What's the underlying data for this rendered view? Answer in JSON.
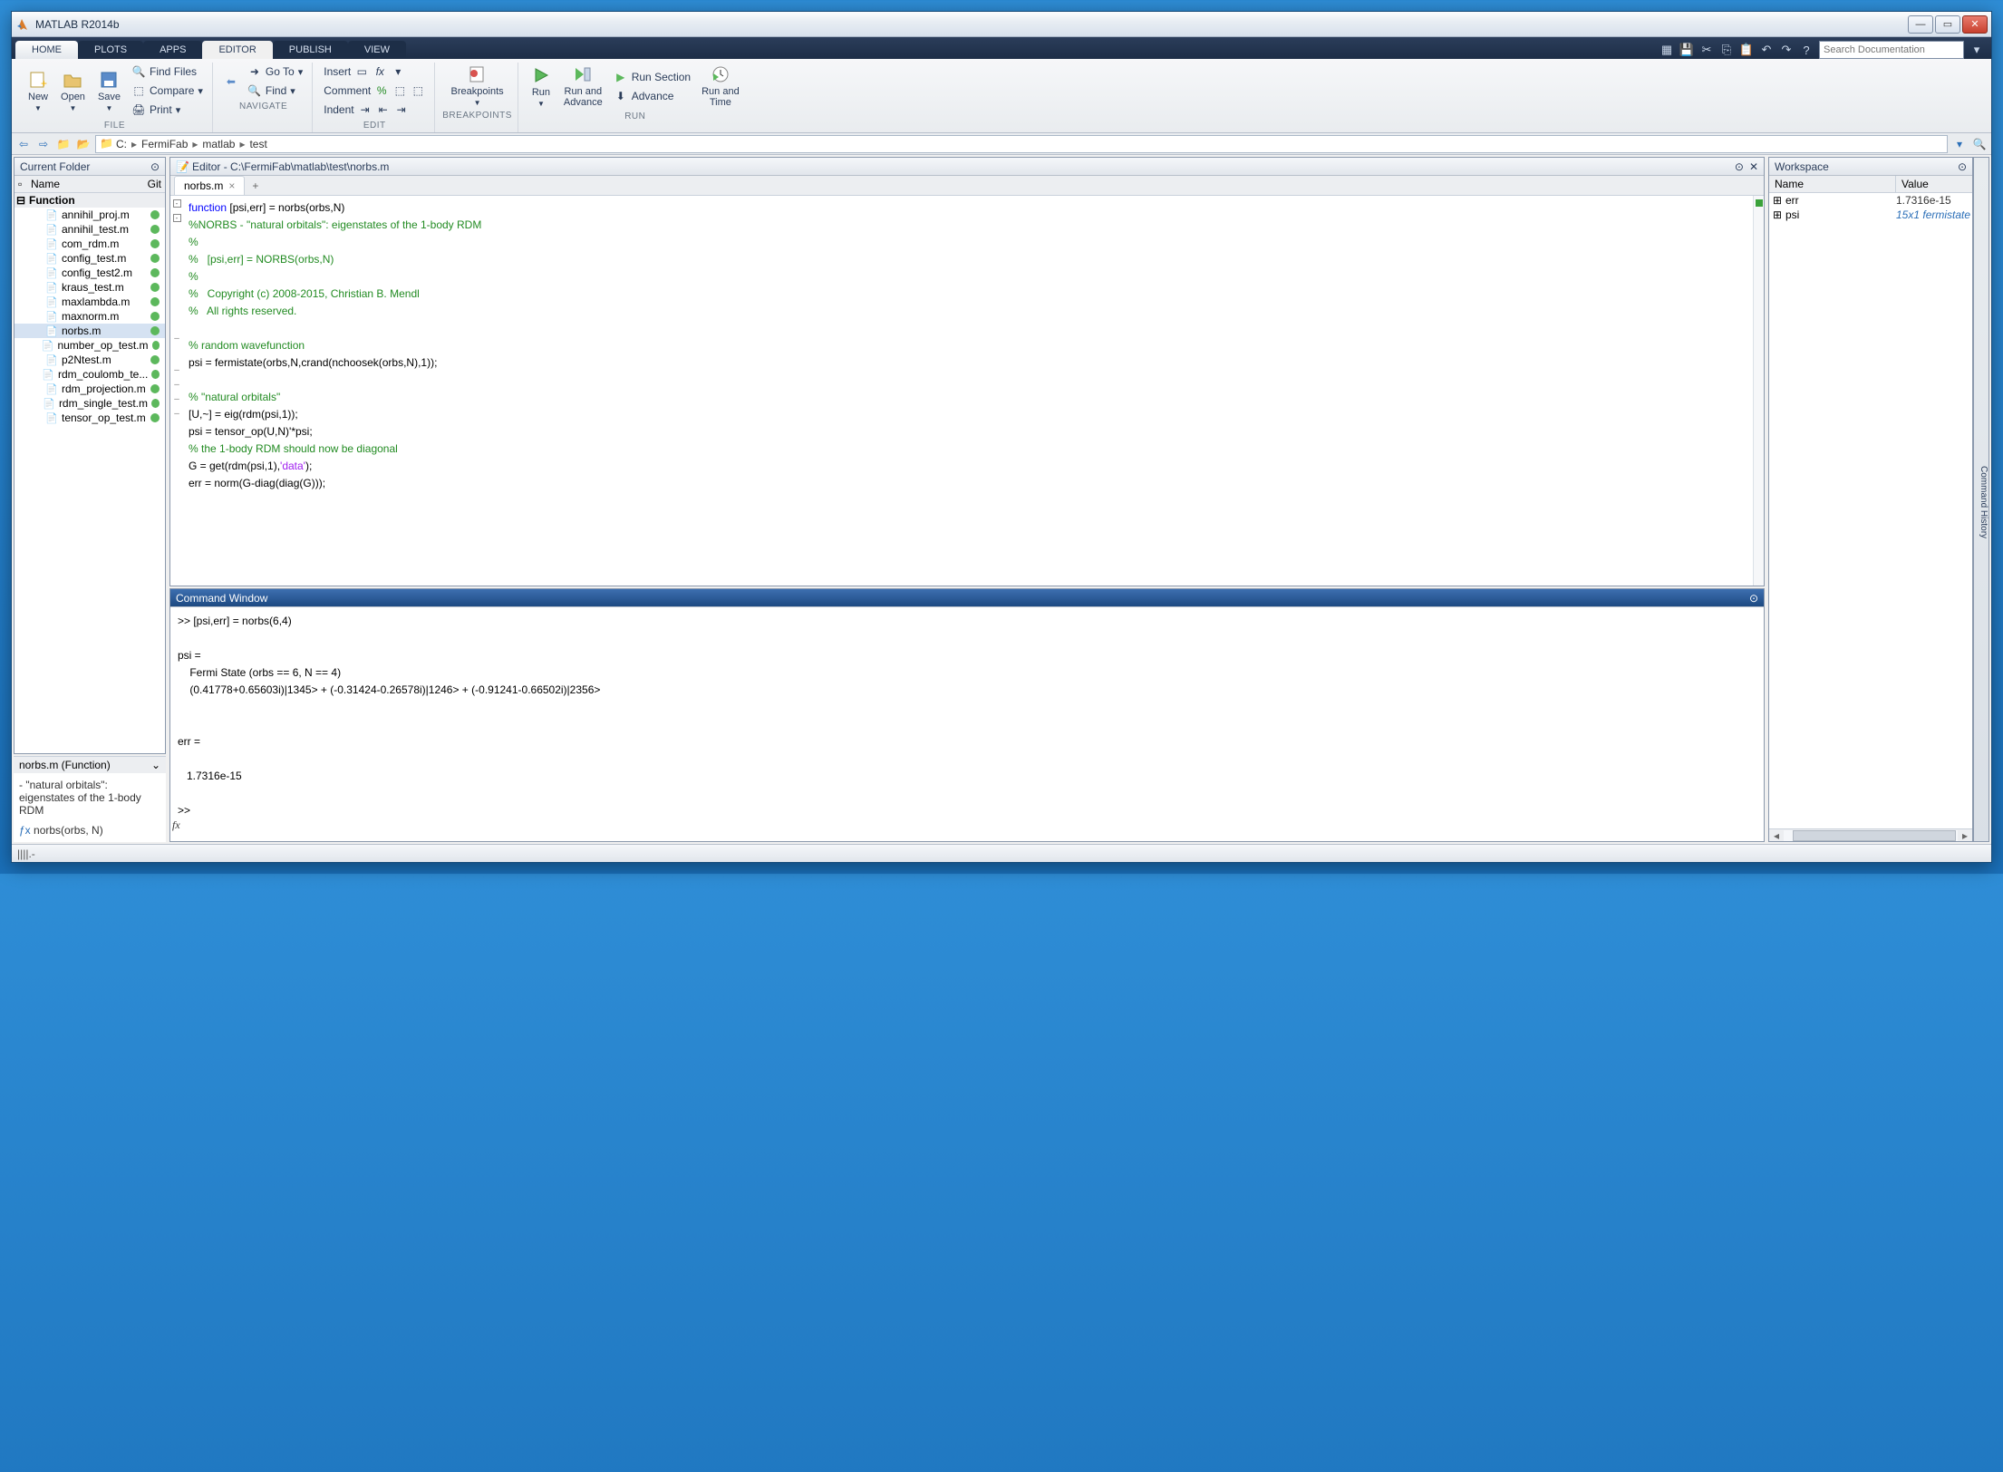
{
  "titlebar": {
    "title": "MATLAB R2014b"
  },
  "main_tabs": [
    "HOME",
    "PLOTS",
    "APPS",
    "EDITOR",
    "PUBLISH",
    "VIEW"
  ],
  "active_main_tab": 3,
  "search_placeholder": "Search Documentation",
  "toolstrip": {
    "file": {
      "new": "New",
      "open": "Open",
      "save": "Save",
      "find_files": "Find Files",
      "compare": "Compare",
      "print": "Print",
      "label": "FILE"
    },
    "navigate": {
      "goto": "Go To",
      "find": "Find",
      "label": "NAVIGATE"
    },
    "edit": {
      "insert": "Insert",
      "comment": "Comment",
      "indent": "Indent",
      "label": "EDIT"
    },
    "breakpoints": {
      "btn": "Breakpoints",
      "label": "BREAKPOINTS"
    },
    "run": {
      "run": "Run",
      "run_advance": "Run and\nAdvance",
      "run_section": "Run Section",
      "advance": "Advance",
      "run_time": "Run and\nTime",
      "label": "RUN"
    }
  },
  "breadcrumb": [
    "C:",
    "FermiFab",
    "matlab",
    "test"
  ],
  "current_folder": {
    "title": "Current Folder",
    "cols": {
      "name": "Name",
      "git": "Git"
    },
    "group": "Function",
    "files": [
      "annihil_proj.m",
      "annihil_test.m",
      "com_rdm.m",
      "config_test.m",
      "config_test2.m",
      "kraus_test.m",
      "maxlambda.m",
      "maxnorm.m",
      "norbs.m",
      "number_op_test.m",
      "p2Ntest.m",
      "rdm_coulomb_te...",
      "rdm_projection.m",
      "rdm_single_test.m",
      "tensor_op_test.m"
    ],
    "selected": "norbs.m"
  },
  "func_panel": {
    "head": "norbs.m (Function)",
    "desc": "- \"natural orbitals\": eigenstates of the 1-body RDM",
    "sig": "norbs(orbs, N)"
  },
  "editor": {
    "title": "Editor - C:\\FermiFab\\matlab\\test\\norbs.m",
    "tab": "norbs.m",
    "code": {
      "l1a": "function",
      "l1b": " [psi,err] = norbs(orbs,N)",
      "l2": "%NORBS - \"natural orbitals\": eigenstates of the 1-body RDM",
      "l3": "%",
      "l4": "%   [psi,err] = NORBS(orbs,N)",
      "l5": "%",
      "l6": "%   Copyright (c) 2008-2015, Christian B. Mendl",
      "l7": "%   All rights reserved.",
      "l9": "% random wavefunction",
      "l10": "psi = fermistate(orbs,N,crand(nchoosek(orbs,N),1));",
      "l12": "% \"natural orbitals\"",
      "l13": "[U,~] = eig(rdm(psi,1));",
      "l14": "psi = tensor_op(U,N)'*psi;",
      "l15": "% the 1-body RDM should now be diagonal",
      "l16a": "G = get(rdm(psi,1),",
      "l16b": "'data'",
      "l16c": ");",
      "l17": "err = norm(G-diag(diag(G)));"
    }
  },
  "command_window": {
    "title": "Command Window",
    "out": ">> [psi,err] = norbs(6,4)\n\npsi = \n    Fermi State (orbs == 6, N == 4)\n    (0.41778+0.65603i)|1345> + (-0.31424-0.26578i)|1246> + (-0.91241-0.66502i)|2356>\n\n\nerr =\n\n   1.7316e-15\n\n>> "
  },
  "workspace": {
    "title": "Workspace",
    "cols": {
      "name": "Name",
      "value": "Value"
    },
    "vars": [
      {
        "name": "err",
        "value": "1.7316e-15",
        "link": false
      },
      {
        "name": "psi",
        "value": "15x1 fermistate",
        "link": true
      }
    ]
  },
  "history_tab": "Command History",
  "status": "||||.-"
}
